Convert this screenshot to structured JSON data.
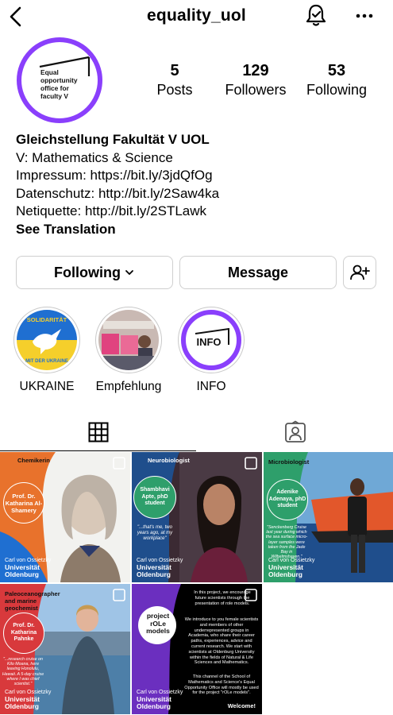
{
  "header": {
    "username": "equality_uol",
    "back_icon": "chevron-left-icon",
    "bell_icon": "bell-icon",
    "more_icon": "more-horizontal-icon"
  },
  "avatar": {
    "text": "Equal opportunity office for faculty V"
  },
  "stats": {
    "posts_count": "5",
    "posts_label": "Posts",
    "followers_count": "129",
    "followers_label": "Followers",
    "following_count": "53",
    "following_label": "Following"
  },
  "bio": {
    "name": "Gleichstellung Fakultät V UOL",
    "line1": "V: Mathematics & Science",
    "line2": "Impressum: https://bit.ly/3jdQfOg",
    "line3": "Datenschutz: http://bit.ly/2Saw4ka",
    "line4": "Netiquette: http://bit.ly/2STLawk",
    "see_translation": "See Translation"
  },
  "actions": {
    "following_label": "Following",
    "message_label": "Message"
  },
  "highlights": [
    {
      "label": "UKRAINE",
      "badge_top": "SOLIDARITÄT",
      "badge_bottom": "MIT DER UKRAINE"
    },
    {
      "label": "Empfehlung"
    },
    {
      "label": "INFO",
      "badge": "INFO"
    }
  ],
  "posts": [
    {
      "tag": "Chemikerin",
      "person": "Prof. Dr. Katharina Al-Shamery",
      "bg": "#e8722c"
    },
    {
      "tag": "Neurobiologist",
      "person": "Shambhavi Apte, phD student",
      "quote": "\"...that's me, two years ago, at my workplace\"",
      "bg": "#1f4e8c"
    },
    {
      "tag": "Microbiologist",
      "person": "Adenike Adenaya, phD student",
      "quote": "\"Senckenberg Cruise last year during which the sea surface micro-layer samples were taken from the Jade Bay in Wilhelmshaven.\"",
      "bg": "#2e9f6b"
    },
    {
      "tag": "Paleoceanographer and marine geochemist",
      "person": "Prof. Dr. Katharina Pahnke",
      "quote": "\"...research cruise on Kilo Moana, here leaving Honolulu, Hawaii. A 5-day cruise where I was chief scientist.\"",
      "bg": "#d8393c"
    },
    {
      "tag": "",
      "person": "project rOLe models",
      "intro": "In this project, we encourage future scientists through the presentation of role models.",
      "body": "We introduce to you female scientists and members of other underrepresented groups in Academia, who share their career paths, experiences, advice and current research. We start with scientists at Oldenburg University within the fields of Natural & Life Sciences and Mathematics.",
      "footer": "This channel of the School of Mathematics and Science's Equal Opportunity Office will mostly be used for the project \"rOLe models\".",
      "welcome": "Welcome!",
      "bg": "#6b2fbf"
    }
  ],
  "university": {
    "line1": "Carl von Ossietzky",
    "line2": "Universität",
    "line3": "Oldenburg"
  },
  "colors": {
    "accent_purple": "#8a3ffc",
    "ukraine_blue": "#1f6fd1",
    "ukraine_yellow": "#f5cf2b"
  }
}
